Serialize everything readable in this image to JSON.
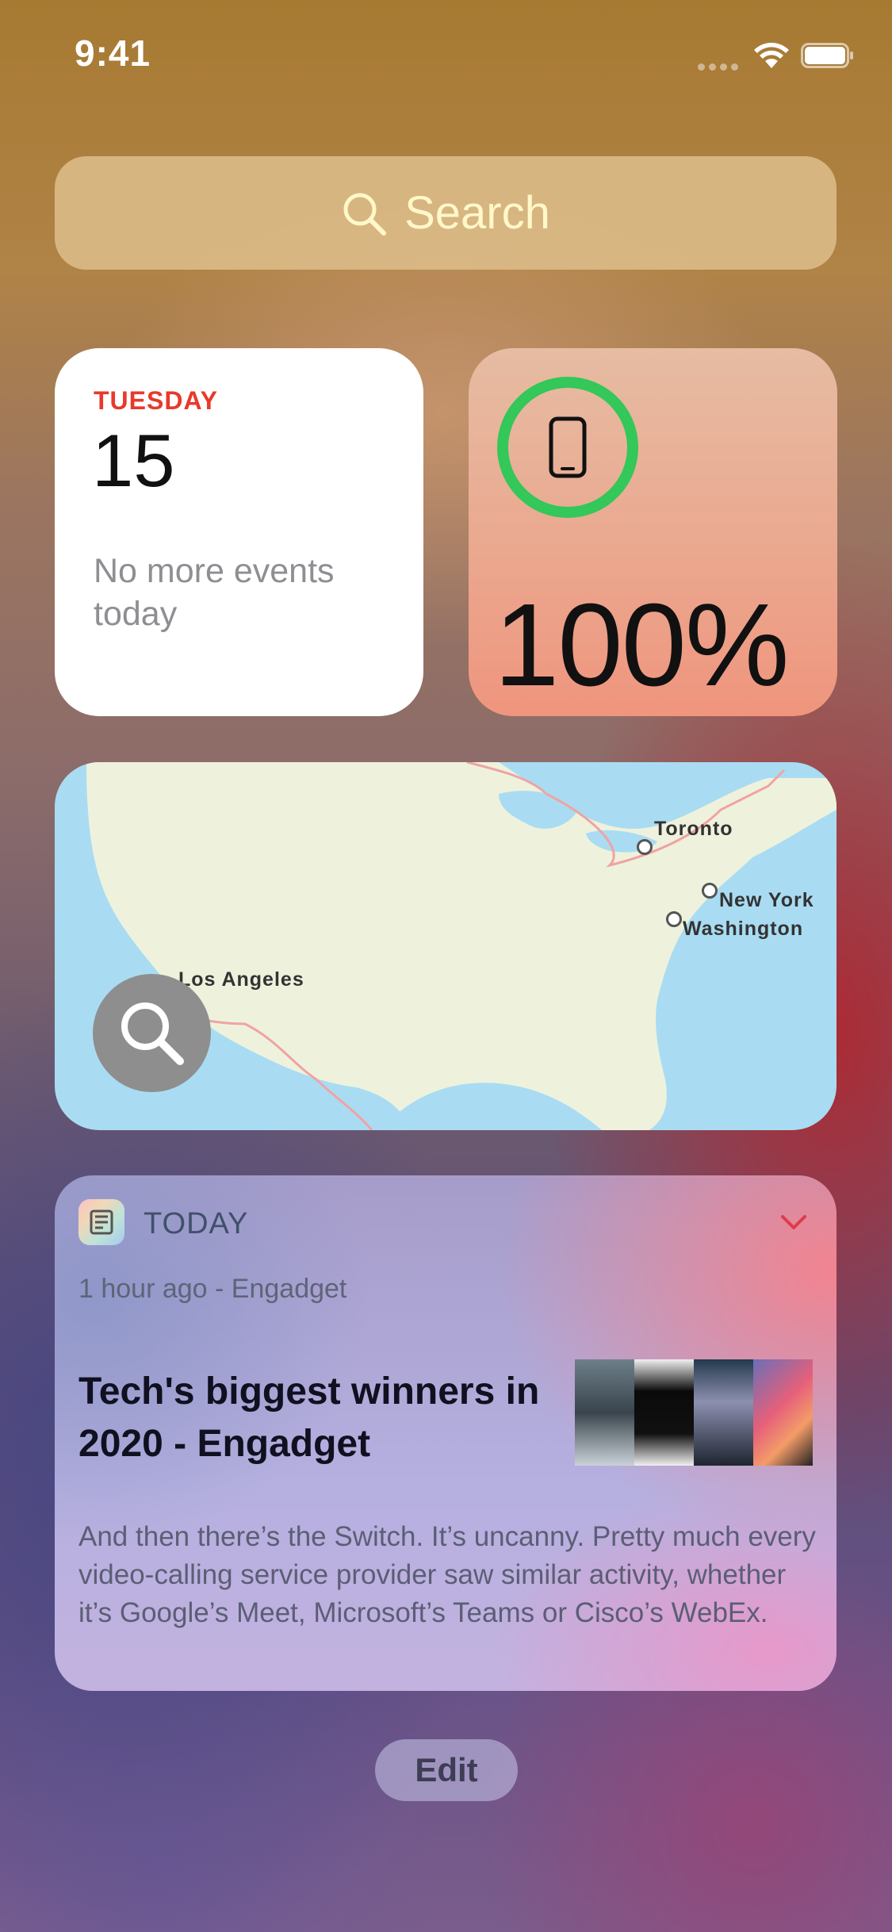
{
  "status_bar": {
    "time": "9:41",
    "icons": [
      "signal-icon",
      "wifi-icon",
      "battery-icon"
    ]
  },
  "search": {
    "label": "Search",
    "icon": "search-icon",
    "color": "#fff8c8"
  },
  "calendar_widget": {
    "day": "TUESDAY",
    "date": "15",
    "message": "No more events today",
    "accent_color": "#e8392b"
  },
  "battery_widget": {
    "percent_label": "100%",
    "level": 1.0,
    "device_icon": "iphone-icon",
    "ring_color": "#34c759"
  },
  "map_widget": {
    "cities": [
      "Toronto",
      "New York",
      "Washington",
      "Los Angeles"
    ],
    "button_icon": "search-icon"
  },
  "news_widget": {
    "app_name": "TODAY",
    "app_icon": "news-icon",
    "meta": "1 hour ago - Engadget",
    "headline": "Tech's biggest winners in 2020 - Engadget",
    "body": "And then there’s the Switch. It’s uncanny. Pretty much every video-calling service provider saw similar activity, whether it’s Google’s Meet, Microsoft’s Teams or Cisco’s WebEx.",
    "chevron_icon": "chevron-down-icon",
    "chevron_color": "#e03a4a"
  },
  "edit_button": {
    "label": "Edit"
  }
}
